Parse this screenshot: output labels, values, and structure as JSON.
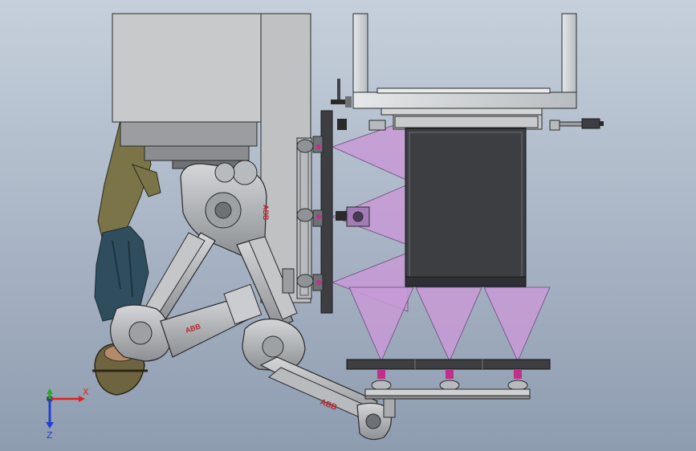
{
  "viewport": {
    "background_top": "#c6d0dc",
    "background_bottom": "#8e9cb0"
  },
  "triad": {
    "x_label": "X",
    "y_label": "Y",
    "z_label": "Z",
    "x_color": "#e02020",
    "y_color": "#20b020",
    "z_color": "#2040d0"
  },
  "colors": {
    "frame_metal": "#cfd3d6",
    "frame_edge": "#2a2a2a",
    "pink_beam": "#c79ad6",
    "dark_box": "#3d3e41",
    "robot_grey": "#a9abad",
    "robot_dark": "#6e7175",
    "robot_label": "#b3262c",
    "human_skin": "#7a7448",
    "human_clothes": "#2f4d5c"
  },
  "robot_labels": {
    "upper_arm_mark": "ABB",
    "forearm_mark": "ABB"
  }
}
